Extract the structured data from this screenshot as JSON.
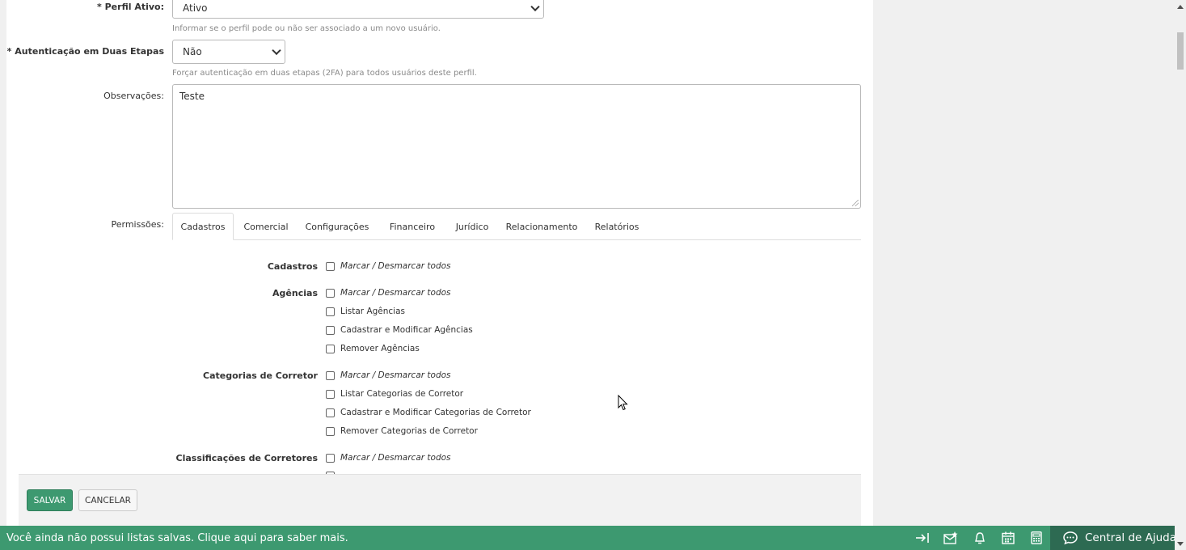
{
  "form": {
    "perfil_ativo": {
      "required_mark": "*",
      "label": "Perfil Ativo:",
      "value": "Ativo",
      "help": "Informar se o perfil pode ou não ser associado a um novo usuário."
    },
    "dois_fatores": {
      "required_mark": "*",
      "label": "Autenticação em Duas Etapas",
      "value": "Não",
      "help": "Forçar autenticação em duas etapas (2FA) para todos usuários deste perfil."
    },
    "observacoes": {
      "label": "Observações:",
      "value": "Teste"
    },
    "permissoes_label": "Permissões:"
  },
  "tabs": [
    {
      "label": "Cadastros",
      "active": true
    },
    {
      "label": "Comercial"
    },
    {
      "label": "Configurações"
    },
    {
      "label": "Financeiro"
    },
    {
      "label": "Jurídico"
    },
    {
      "label": "Relacionamento"
    },
    {
      "label": "Relatórios"
    }
  ],
  "permissions": {
    "groups": [
      {
        "label": "Cadastros",
        "items": [
          "Marcar / Desmarcar todos"
        ]
      },
      {
        "label": "Agências",
        "items": [
          "Marcar / Desmarcar todos",
          "Listar Agências",
          "Cadastrar e Modificar Agências",
          "Remover Agências"
        ]
      },
      {
        "label": "Categorias de Corretor",
        "items": [
          "Marcar / Desmarcar todos",
          "Listar Categorias de Corretor",
          "Cadastrar e Modificar Categorias de Corretor",
          "Remover Categorias de Corretor"
        ]
      },
      {
        "label": "Classificações de Corretores",
        "items": [
          "Marcar / Desmarcar todos"
        ]
      }
    ]
  },
  "actions": {
    "save_label": "SALVAR",
    "cancel_label": "CANCELAR"
  },
  "bottom_bar": {
    "message": "Você ainda não possui listas salvas. Clique aqui para saber mais.",
    "help_center_label": "Central de Ajuda",
    "icons": [
      "collapse-right-icon",
      "favorite-mail-icon",
      "bell-icon",
      "calendar-icon",
      "calculator-icon",
      "chat-icon"
    ]
  },
  "colors": {
    "brand_green": "#3d9970",
    "help_center_bg": "#2d6a52"
  }
}
